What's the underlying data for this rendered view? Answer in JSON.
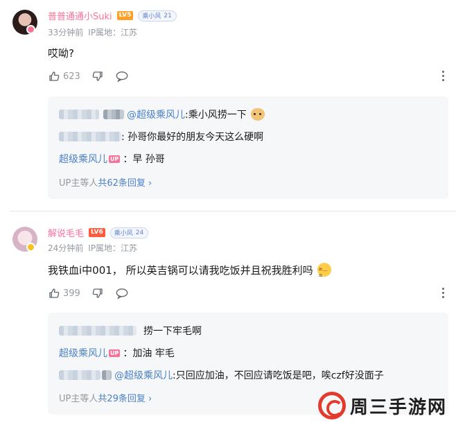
{
  "comments": [
    {
      "username": "普普通通小Suki",
      "level": "LV5",
      "fan_medal": {
        "name": "乘小风",
        "level": "21"
      },
      "time": "33分钟前",
      "ip": "IP属地：江苏",
      "content": "哎呦?",
      "likes": "623",
      "replies": [
        {
          "blur_user": true,
          "mention": "@超级乘风儿",
          "text": ":乘小风捞一下",
          "emoji": "doge-emoji"
        },
        {
          "blur_user": true,
          "text": ": 孙哥你最好的朋友今天这么硬啊"
        },
        {
          "user": "超级乘风儿",
          "up_badge": "UP",
          "text": "：早 孙哥"
        }
      ],
      "more_prefix": "UP主等人",
      "more_count": "共62条回复",
      "more_arrow": "›"
    },
    {
      "username": "解说毛毛",
      "level": "LV6",
      "fan_medal": {
        "name": "乘小风",
        "level": "24"
      },
      "time": "24分钟前",
      "ip": "IP属地：江苏",
      "content": "我铁血i中001， 所以英吉锅可以请我吃饭并且祝我胜利吗",
      "content_emoji": "shy-emoji",
      "likes": "399",
      "replies": [
        {
          "blur_user": true,
          "text": "捞一下牢毛啊"
        },
        {
          "user": "超级乘风儿",
          "up_badge": "UP",
          "text": "：加油 牢毛"
        },
        {
          "blur_user": true,
          "mention": "@超级乘风儿",
          "text": ":只回应加油，不回应请吃饭是吧，唉czf好没面子"
        }
      ],
      "more_prefix": "UP主等人",
      "more_count": "共29条回复",
      "more_arrow": "›"
    }
  ],
  "icons": {
    "like": "thumbs-up-icon",
    "dislike": "thumbs-down-icon",
    "reply": "comment-bubble-icon",
    "more": "more-vertical-icon"
  },
  "watermark": {
    "text": "周三手游网"
  },
  "colors": {
    "username": "#fb7299",
    "link": "#4a81c6",
    "meta": "#9499a0",
    "reply_bg": "#f6f7f8"
  }
}
